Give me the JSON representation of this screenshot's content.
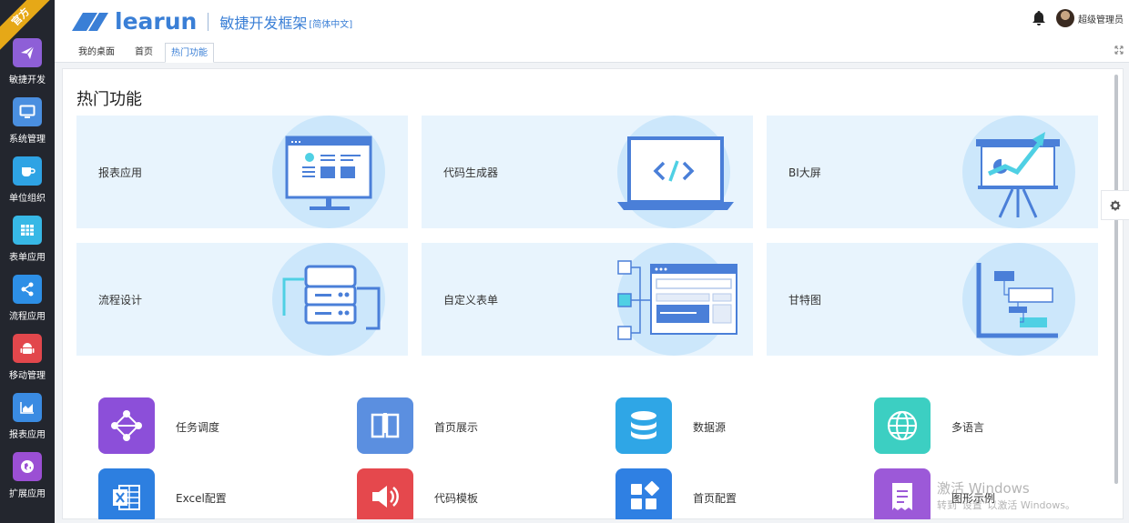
{
  "brand": {
    "ribbon": "官方",
    "logo_word": "learun",
    "subtitle": "敏捷开发框架",
    "lang": "[简体中文]"
  },
  "user": {
    "name": "超级管理员"
  },
  "sidebar": {
    "items": [
      {
        "label": "敏捷开发",
        "icon": "paper-plane-icon",
        "color": "#8e5fd7"
      },
      {
        "label": "系统管理",
        "icon": "monitor-icon",
        "color": "#4a8fe0"
      },
      {
        "label": "单位组织",
        "icon": "cup-icon",
        "color": "#2ea3e4"
      },
      {
        "label": "表单应用",
        "icon": "grid-icon",
        "color": "#37b8e6"
      },
      {
        "label": "流程应用",
        "icon": "share-icon",
        "color": "#2d8fe6"
      },
      {
        "label": "移动管理",
        "icon": "android-icon",
        "color": "#e2474c"
      },
      {
        "label": "报表应用",
        "icon": "area-chart-icon",
        "color": "#3a8be2"
      },
      {
        "label": "扩展应用",
        "icon": "globe-icon",
        "color": "#9b4fd4"
      }
    ]
  },
  "tabs": [
    {
      "label": "我的桌面"
    },
    {
      "label": "首页"
    },
    {
      "label": "热门功能"
    }
  ],
  "main": {
    "title": "热门功能",
    "cards": [
      {
        "title": "报表应用"
      },
      {
        "title": "代码生成器"
      },
      {
        "title": "BI大屏"
      },
      {
        "title": "流程设计"
      },
      {
        "title": "自定义表单"
      },
      {
        "title": "甘特图"
      }
    ],
    "apps": [
      {
        "label": "任务调度",
        "icon": "flow-nodes-icon",
        "color": "#8c4fd9"
      },
      {
        "label": "首页展示",
        "icon": "book-icon",
        "color": "#5b8fe0"
      },
      {
        "label": "数据源",
        "icon": "database-icon",
        "color": "#2fa6e6"
      },
      {
        "label": "多语言",
        "icon": "globe-icon",
        "color": "#3ccfc2"
      },
      {
        "label": "Excel配置",
        "icon": "excel-icon",
        "color": "#2d7fe0"
      },
      {
        "label": "代码模板",
        "icon": "speaker-icon",
        "color": "#e5484d"
      },
      {
        "label": "首页配置",
        "icon": "blocks-icon",
        "color": "#2f80e3"
      },
      {
        "label": "图形示例",
        "icon": "document-icon",
        "color": "#9c59d8"
      }
    ]
  },
  "watermark": {
    "line1": "激活 Windows",
    "line2": "转到“设置”以激活 Windows。"
  }
}
